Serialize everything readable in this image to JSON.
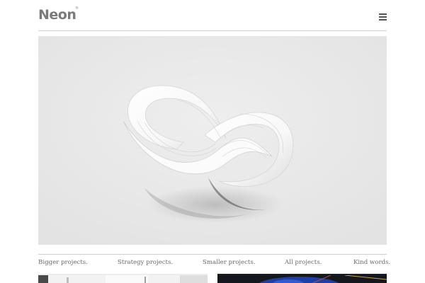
{
  "header": {
    "logo_text": "Neon",
    "logo_mark": "®",
    "menu_icon": "hamburger-menu-icon"
  },
  "hero": {
    "image": "white-ribbon-sculpture",
    "background_color": "#e6e6e6"
  },
  "nav": {
    "items": [
      {
        "label": "Bigger projects."
      },
      {
        "label": "Strategy projects."
      },
      {
        "label": "Smaller projects."
      },
      {
        "label": "All projects."
      },
      {
        "label": "Kind words."
      }
    ]
  },
  "thumbnails": [
    {
      "image": "bright-interior-photo"
    },
    {
      "image": "dark-blue-sphere-photo"
    }
  ]
}
